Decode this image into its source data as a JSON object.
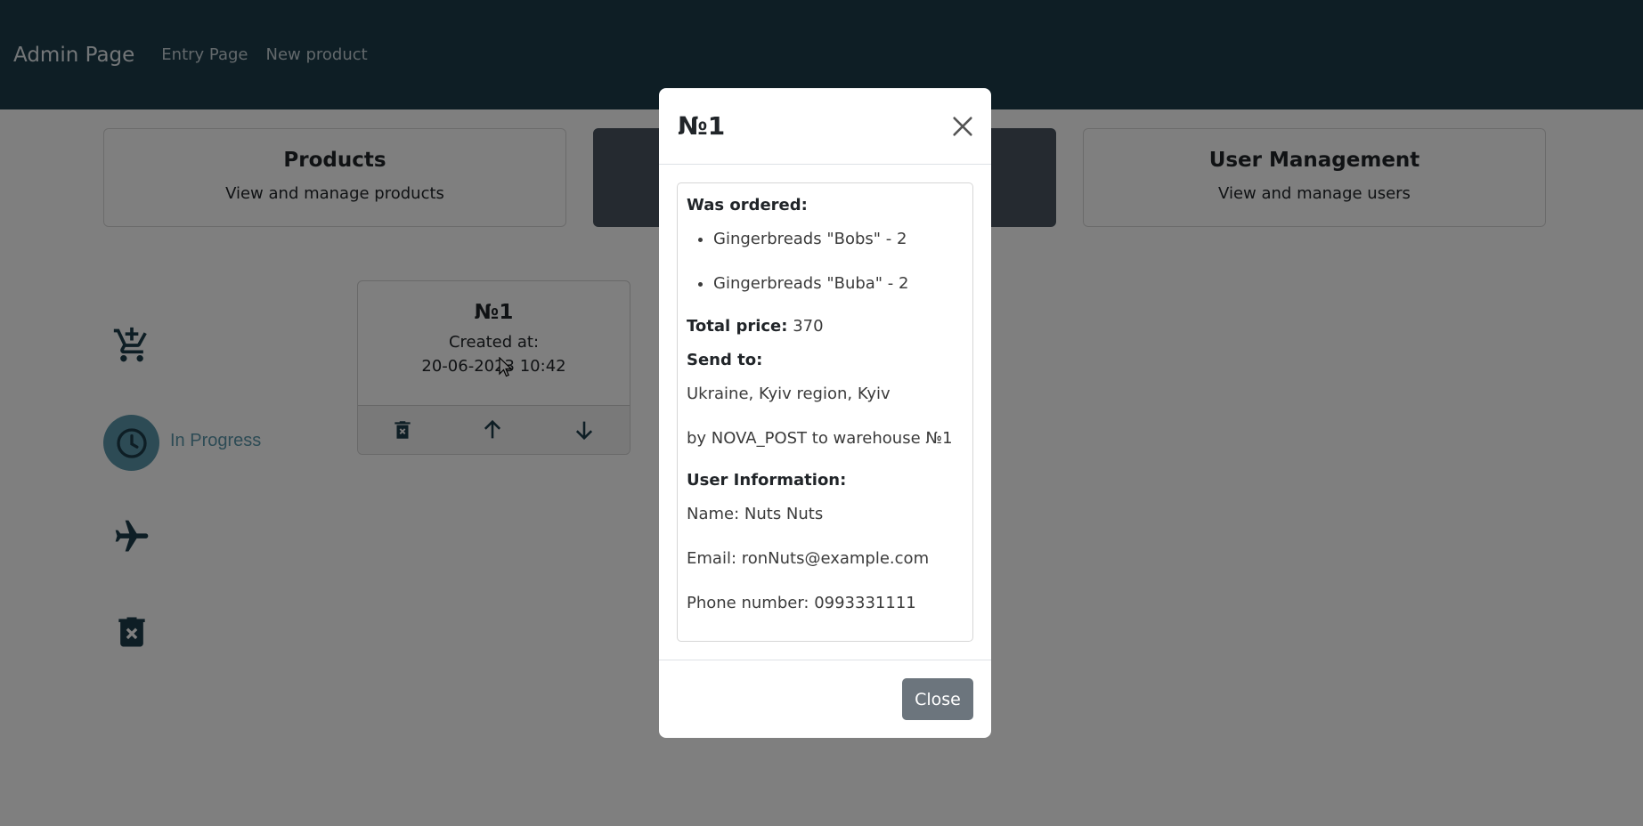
{
  "navbar": {
    "brand": "Admin Page",
    "links": [
      "Entry Page",
      "New product"
    ]
  },
  "tiles": [
    {
      "title": "Products",
      "subtitle": "View and manage products"
    },
    {
      "title": "",
      "subtitle": ""
    },
    {
      "title": "User Management",
      "subtitle": "View and manage users"
    }
  ],
  "sidebar": {
    "in_progress_label": "In Progress"
  },
  "order_card": {
    "title": "№1",
    "created_label": "Created at:",
    "created_value": "20-06-2023 10:42"
  },
  "modal": {
    "title": "№1",
    "ordered_label": "Was ordered:",
    "items": [
      "Gingerbreads \"Bobs\" - 2",
      "Gingerbreads \"Buba\" - 2"
    ],
    "total_label": "Total price:",
    "total_value": "370",
    "send_to_label": "Send to:",
    "address": "Ukraine, Kyiv region, Kyiv",
    "delivery": "by NOVA_POST to warehouse №1",
    "user_info_label": "User Information:",
    "name": "Name: Nuts Nuts",
    "email": "Email: ronNuts@example.com",
    "phone": "Phone number: 0993331111",
    "close_button": "Close"
  },
  "colors": {
    "navbar": "#1d3d4b",
    "status_accent": "#5b97ab",
    "close_button": "#6c757d"
  }
}
